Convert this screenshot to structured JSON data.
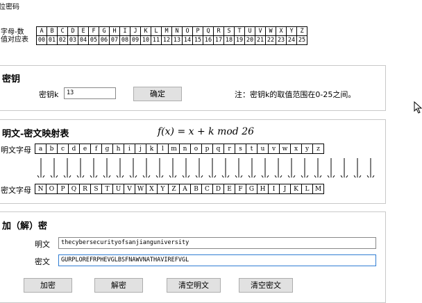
{
  "page_title": "位密码",
  "code_table": {
    "label1": "字母-数",
    "label2": "值对应表",
    "letters": [
      "A",
      "B",
      "C",
      "D",
      "E",
      "F",
      "G",
      "H",
      "I",
      "J",
      "K",
      "L",
      "M",
      "N",
      "O",
      "P",
      "Q",
      "R",
      "S",
      "T",
      "U",
      "V",
      "W",
      "X",
      "Y",
      "Z"
    ],
    "numbers": [
      "00",
      "01",
      "02",
      "03",
      "04",
      "05",
      "06",
      "07",
      "08",
      "09",
      "10",
      "11",
      "12",
      "13",
      "14",
      "15",
      "16",
      "17",
      "18",
      "19",
      "20",
      "21",
      "22",
      "23",
      "24",
      "25"
    ]
  },
  "key_panel": {
    "title": "密钥",
    "key_label": "密钥k",
    "key_value": "13",
    "confirm_label": "确定",
    "note": "注：密钥k的取值范围在0-25之间。"
  },
  "map_panel": {
    "title": "明文-密文映射表",
    "formula": "f(x) = x + k mod 26",
    "plain_label": "明文字母",
    "cipher_label": "密文字母",
    "plain_letters": [
      "a",
      "b",
      "c",
      "d",
      "e",
      "f",
      "g",
      "h",
      "i",
      "j",
      "k",
      "l",
      "m",
      "n",
      "o",
      "p",
      "q",
      "r",
      "s",
      "t",
      "u",
      "v",
      "w",
      "x",
      "y",
      "z"
    ],
    "cipher_letters": [
      "N",
      "O",
      "P",
      "Q",
      "R",
      "S",
      "T",
      "U",
      "V",
      "W",
      "X",
      "Y",
      "Z",
      "A",
      "B",
      "C",
      "D",
      "E",
      "F",
      "G",
      "H",
      "I",
      "J",
      "K",
      "L",
      "M"
    ]
  },
  "crypt_panel": {
    "title": "加（解）密",
    "plain_label": "明文",
    "plain_value": "thecybersecurityofsanjianguniversity",
    "cipher_label": "密文",
    "cipher_value": "GURPLOREFRPHEVGLBSFNAWVNATHAVIREFVGL",
    "encrypt_label": "加密",
    "decrypt_label": "解密",
    "clear_plain_label": "清空明文",
    "clear_cipher_label": "清空密文"
  }
}
